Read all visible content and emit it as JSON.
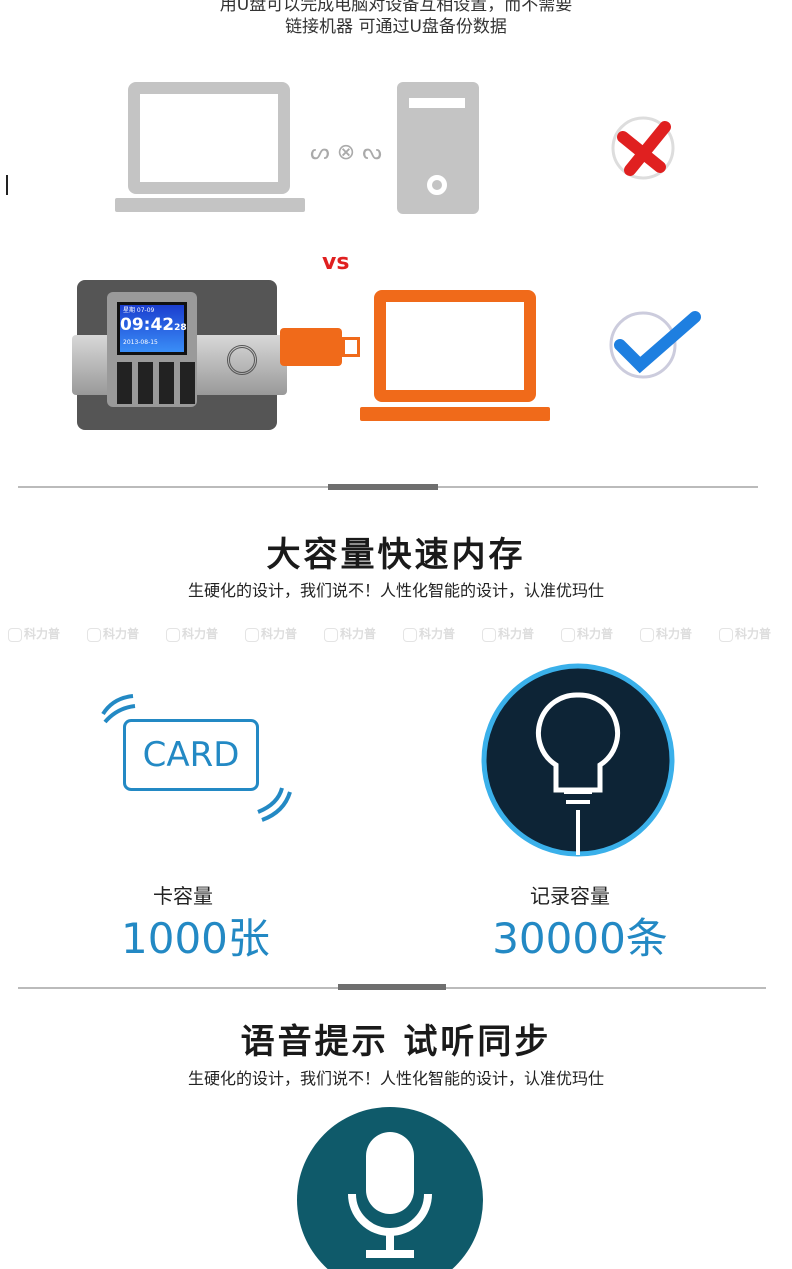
{
  "intro": {
    "line1": "用U盘可以完成电脑对设备互相设置，而不需要",
    "line2": "链接机器 可通过U盘备份数据",
    "vs_label": "vs"
  },
  "device": {
    "time": "09:42",
    "seconds": "28",
    "date": "2013-08-15",
    "header": "星期 07-09"
  },
  "section_memory": {
    "title": "大容量快速内存",
    "subtitle": "生硬化的设计，我们说不！人性化智能的设计，认准优玛仕",
    "watermark": "科力普",
    "card_label": "CARD",
    "card_caption": "卡容量",
    "card_value": "1000张",
    "record_caption": "记录容量",
    "record_value": "30000条"
  },
  "section_voice": {
    "title": "语音提示 试听同步",
    "subtitle": "生硬化的设计，我们说不！人性化智能的设计，认准优玛仕"
  },
  "colors": {
    "accent_blue": "#2389c4",
    "orange": "#f06a1a",
    "red": "#e02020"
  }
}
